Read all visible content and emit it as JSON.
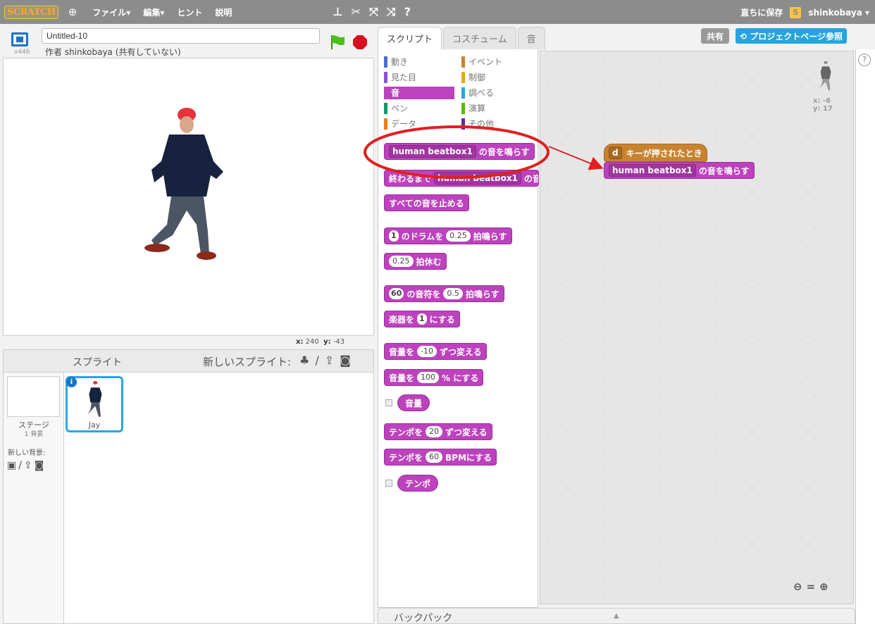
{
  "topbar": {
    "logo": "SCRATCH",
    "menus": [
      "ファイル▾",
      "編集▾",
      "ヒント",
      "説明"
    ],
    "save_now": "直ちに保存",
    "username": "shinkobaya ▾"
  },
  "project": {
    "title": "Untitled-10",
    "author_line": "作者 shinkobaya (共有していない)",
    "version": "v446"
  },
  "stage": {
    "x_label": "x:",
    "x_value": "240",
    "y_label": "y:",
    "y_value": "-43"
  },
  "sprites": {
    "header": "スプライト",
    "new_sprite": "新しいスプライト:",
    "stage_label": "ステージ",
    "stage_count": "1 背景",
    "new_backdrop": "新しい背景:",
    "sprite_name": "Jay"
  },
  "tabs": [
    "スクリプト",
    "コスチューム",
    "音"
  ],
  "share": "共有",
  "project_page": "プロジェクトページ参照",
  "categories": {
    "motion": "動き",
    "looks": "見た目",
    "sound": "音",
    "pen": "ペン",
    "data": "データ",
    "events": "イベント",
    "control": "制御",
    "sensing": "調べる",
    "operators": "演算",
    "more": "その他"
  },
  "blocks": {
    "play_sound_val": "human beatbox1",
    "play_sound_txt": "の音を鳴らす",
    "play_until_pre": "終わるまで",
    "play_until_val": "human beatbox1",
    "play_until_txt": "の音",
    "stop_all": "すべての音を止める",
    "drum_val": "1",
    "drum_txt1": "のドラムを",
    "drum_num": "0.25",
    "drum_txt2": "拍鳴らす",
    "rest_num": "0.25",
    "rest_txt": "拍休む",
    "note_val": "60",
    "note_txt1": "の音符を",
    "note_num": "0.5",
    "note_txt2": "拍鳴らす",
    "inst_txt1": "楽器を",
    "inst_val": "1",
    "inst_txt2": "にする",
    "vol_change_txt1": "音量を",
    "vol_change_num": "-10",
    "vol_change_txt2": "ずつ変える",
    "vol_set_txt1": "音量を",
    "vol_set_num": "100",
    "vol_set_txt2": "% にする",
    "volume": "音量",
    "tempo_change_txt1": "テンポを",
    "tempo_change_num": "20",
    "tempo_change_txt2": "ずつ変える",
    "tempo_set_txt1": "テンポを",
    "tempo_set_num": "60",
    "tempo_set_txt2": "BPMにする",
    "tempo": "テンポ"
  },
  "script": {
    "hat_key": "d",
    "hat_txt": "キーが押されたとき",
    "sound_val": "human beatbox1",
    "sound_txt": "の音を鳴らす",
    "x_readout": "x: -6",
    "y_readout": "y: 17"
  },
  "backpack": "バックパック",
  "colors": {
    "sound_block": "#bd42bd",
    "events_block": "#c88330",
    "annotation": "#e02020",
    "motion": "#4a6cd4",
    "looks": "#8a55d7",
    "pen": "#0e9a6c",
    "data": "#ee7d16",
    "events": "#c88330",
    "control": "#e1a91a",
    "sensing": "#2ca5e2",
    "operators": "#5cb712",
    "more": "#632d99"
  }
}
